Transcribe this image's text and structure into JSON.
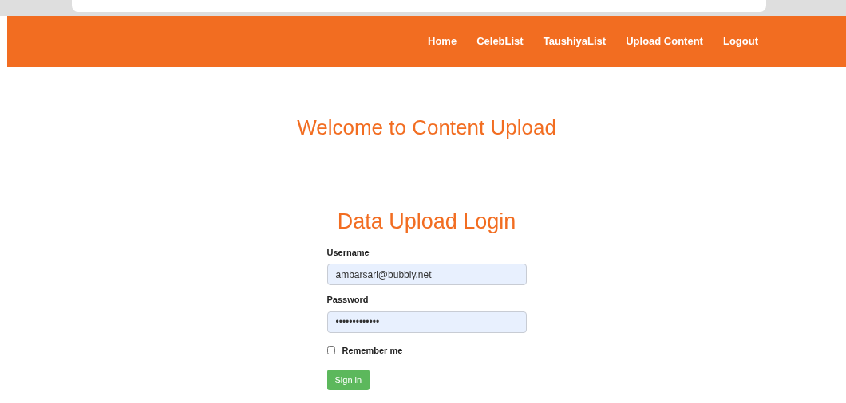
{
  "nav": {
    "items": [
      {
        "label": "Home"
      },
      {
        "label": "CelebList"
      },
      {
        "label": "TaushiyaList"
      },
      {
        "label": "Upload Content"
      },
      {
        "label": "Logout"
      }
    ]
  },
  "page_title": "Welcome to Content Upload",
  "login": {
    "title": "Data Upload Login",
    "fields": [
      {
        "label": "Username",
        "value": "ambarsari@bubbly.net"
      },
      {
        "label": "Password",
        "value": "•••••••••••••"
      }
    ],
    "remember": {
      "label": "Remember me",
      "checked": false
    },
    "submit": "Sign in"
  }
}
